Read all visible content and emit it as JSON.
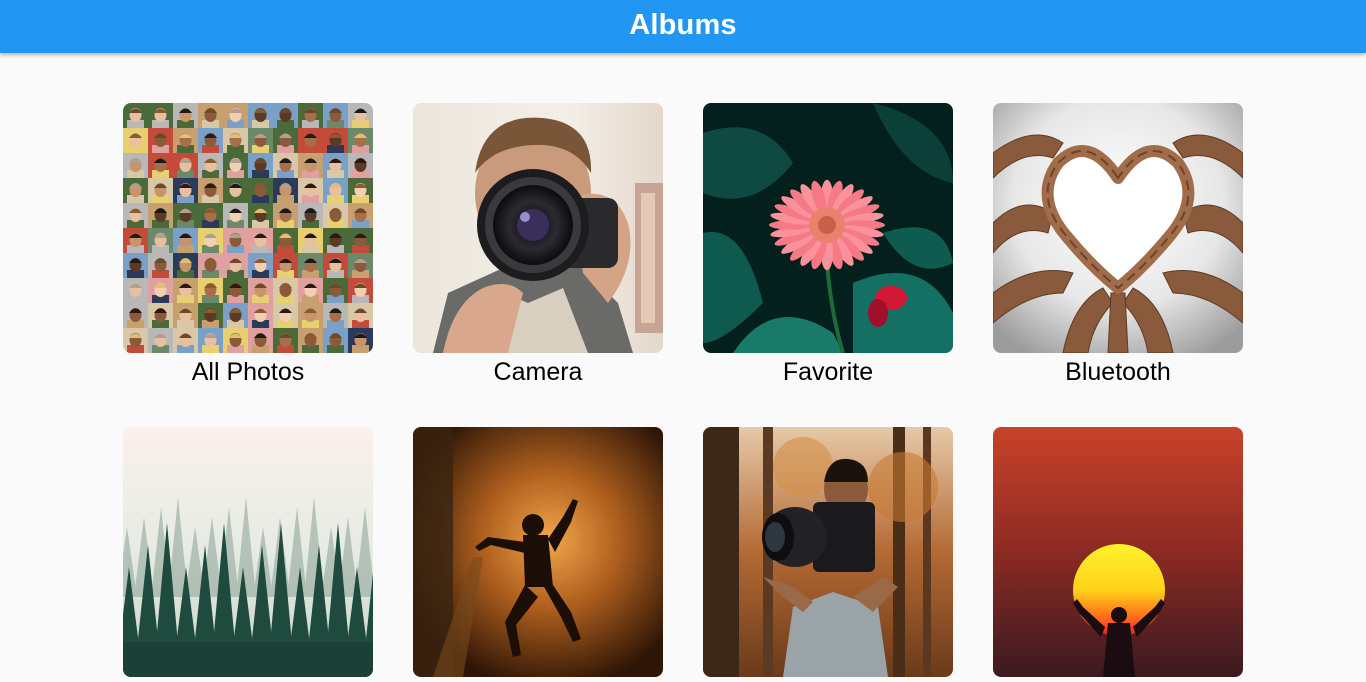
{
  "app_bar": {
    "title": "Albums",
    "color": "#2196f3"
  },
  "albums": [
    {
      "label": "All Photos",
      "thumbnail": "portrait-collage-image"
    },
    {
      "label": "Camera",
      "thumbnail": "man-with-camera-image"
    },
    {
      "label": "Favorite",
      "thumbnail": "pink-flower-image"
    },
    {
      "label": "Bluetooth",
      "thumbnail": "hands-heart-image"
    },
    {
      "label": "",
      "thumbnail": "misty-forest-image"
    },
    {
      "label": "",
      "thumbnail": "silhouette-dancer-image"
    },
    {
      "label": "",
      "thumbnail": "camera-levitate-image"
    },
    {
      "label": "",
      "thumbnail": "sun-hands-image"
    }
  ]
}
